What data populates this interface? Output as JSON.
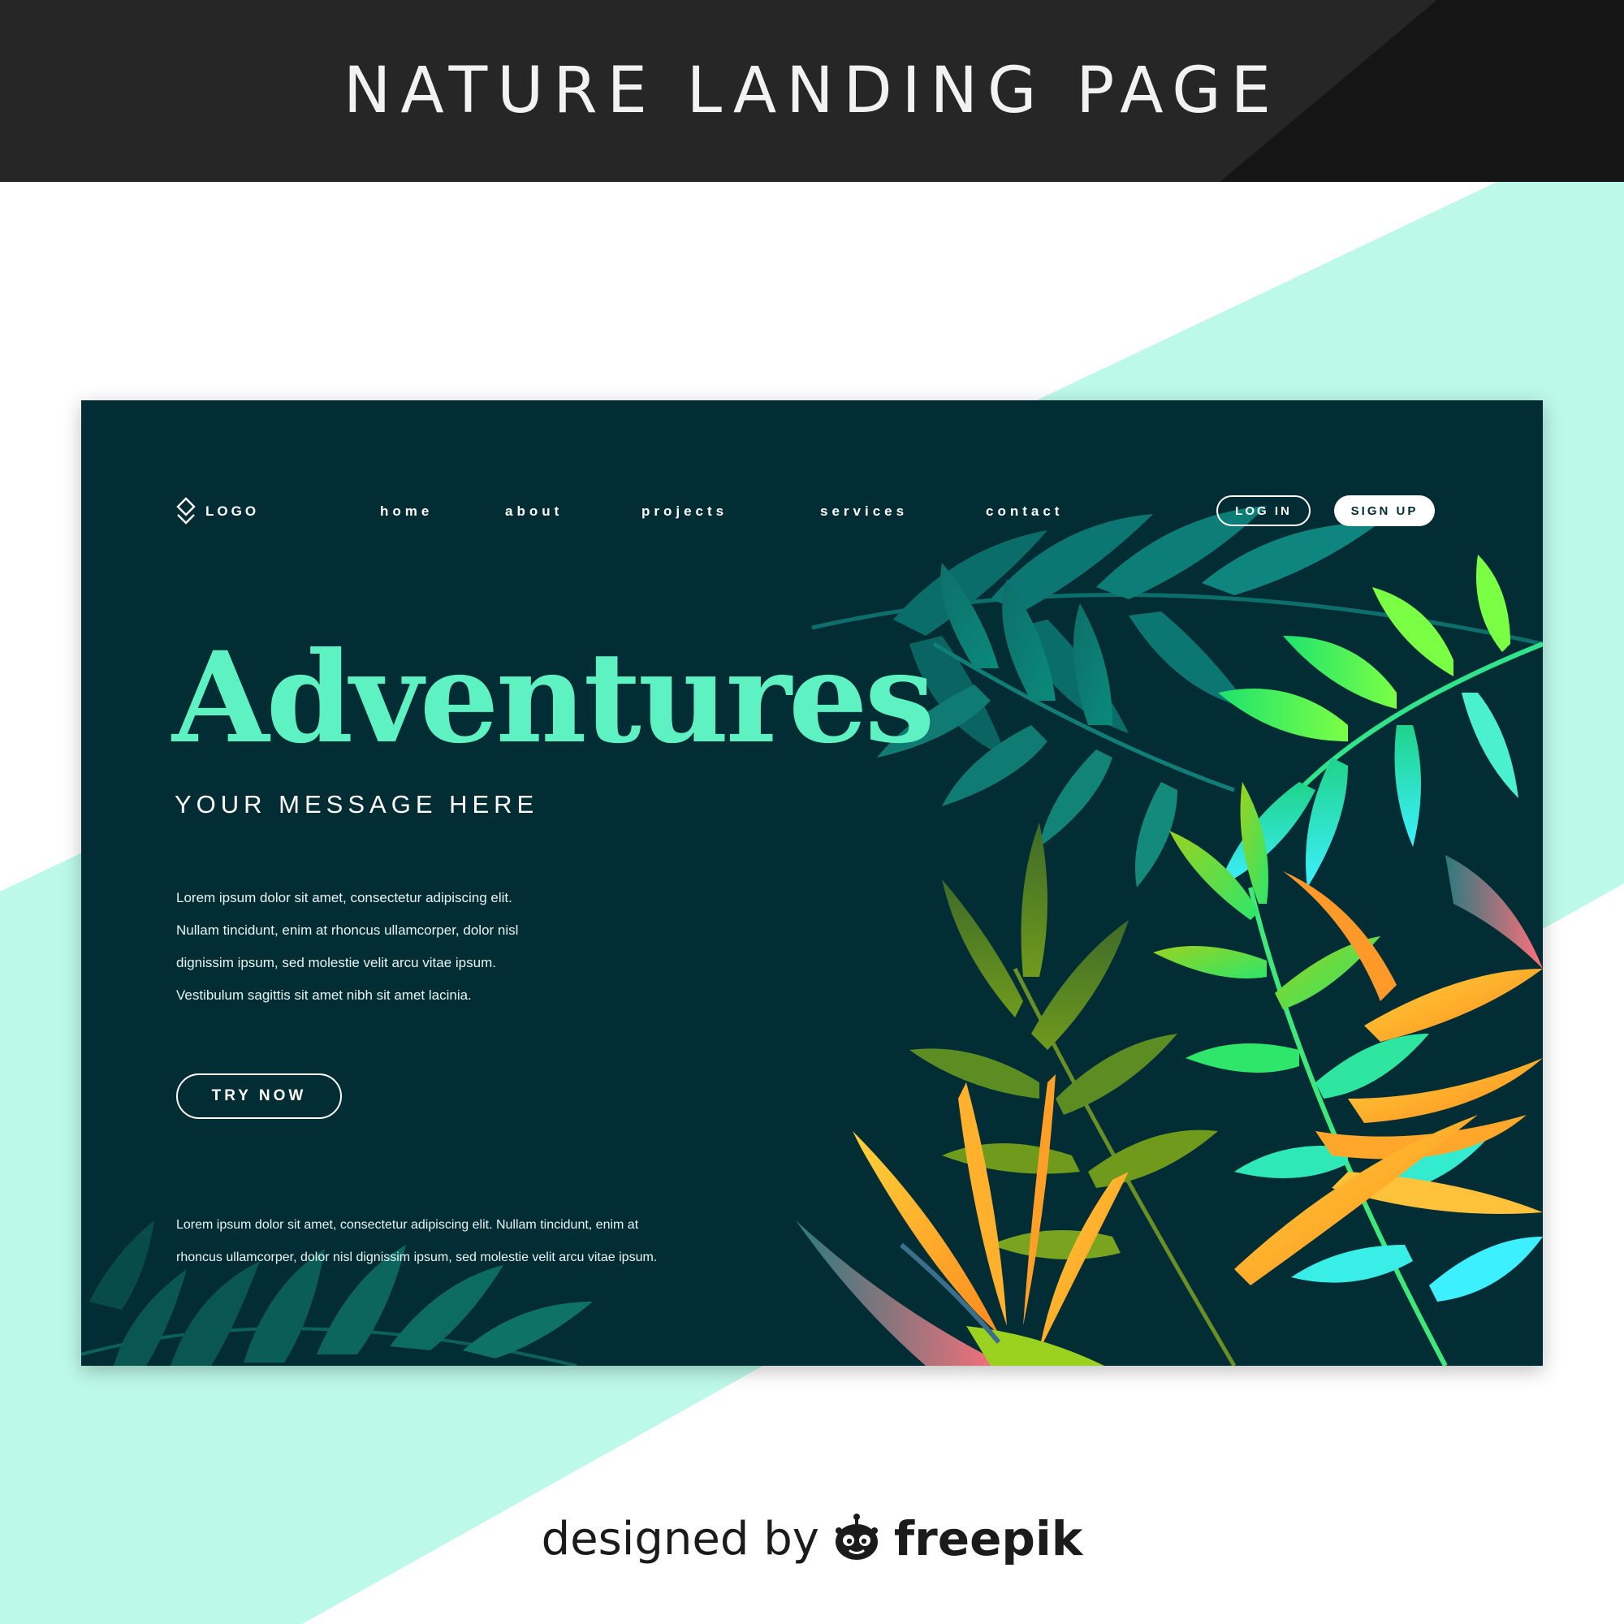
{
  "banner": {
    "title": "NATURE LANDING PAGE"
  },
  "colors": {
    "card_background": "#022d35",
    "accent": "#5ef2c2",
    "mint_backdrop": "#bdf9e8",
    "banner_background": "#262626"
  },
  "header": {
    "logo_icon": "diamond-stack-icon",
    "logo_text": "LOGO",
    "nav": [
      "home",
      "about",
      "projects",
      "services",
      "contact"
    ],
    "login_label": "LOG IN",
    "signup_label": "SIGN UP"
  },
  "hero": {
    "title": "Adventures",
    "subtitle": "YOUR MESSAGE HERE",
    "body_lines": [
      "Lorem ipsum dolor sit amet, consectetur adipiscing elit.",
      "Nullam tincidunt, enim at rhoncus ullamcorper, dolor nisl",
      "dignissim ipsum, sed molestie velit arcu vitae ipsum.",
      "Vestibulum sagittis sit amet nibh sit amet lacinia."
    ],
    "cta_label": "TRY NOW"
  },
  "footer": {
    "lines": [
      "Lorem ipsum dolor sit amet, consectetur adipiscing elit. Nullam tincidunt, enim at",
      "rhoncus ullamcorper, dolor nisl dignissim ipsum, sed molestie velit arcu vitae ipsum."
    ]
  },
  "credit": {
    "designed_by": "designed by",
    "brand": "freepik",
    "brand_icon": "freepik-mascot-icon"
  }
}
